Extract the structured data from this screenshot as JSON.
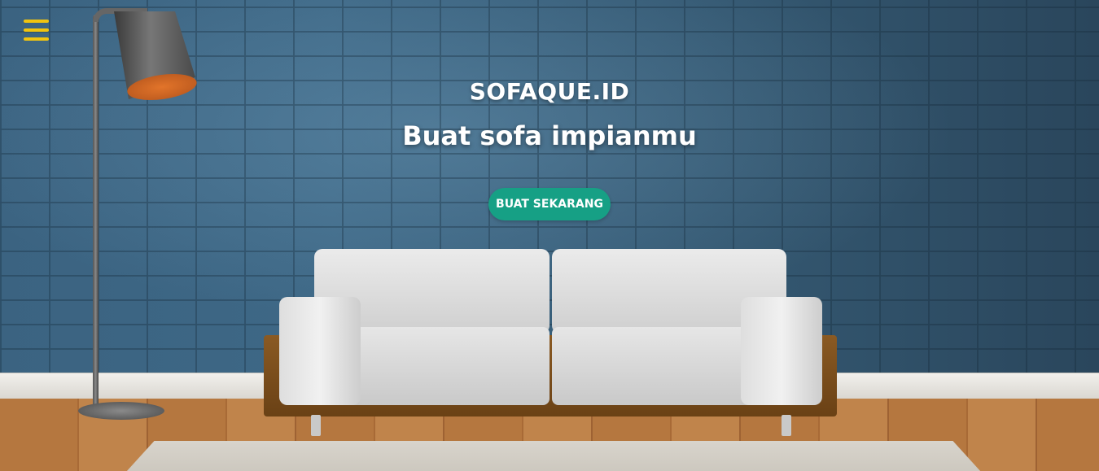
{
  "nav": {
    "menu_icon": "hamburger-menu-icon",
    "menu_color": "#f1c40f"
  },
  "hero": {
    "brand": "SOFAQUE.ID",
    "tagline": "Buat sofa impianmu",
    "cta_label": "BUAT SEKARANG",
    "cta_color": "#16a085",
    "background": "living room with blue brick wall, floor lamp and white sofa"
  }
}
